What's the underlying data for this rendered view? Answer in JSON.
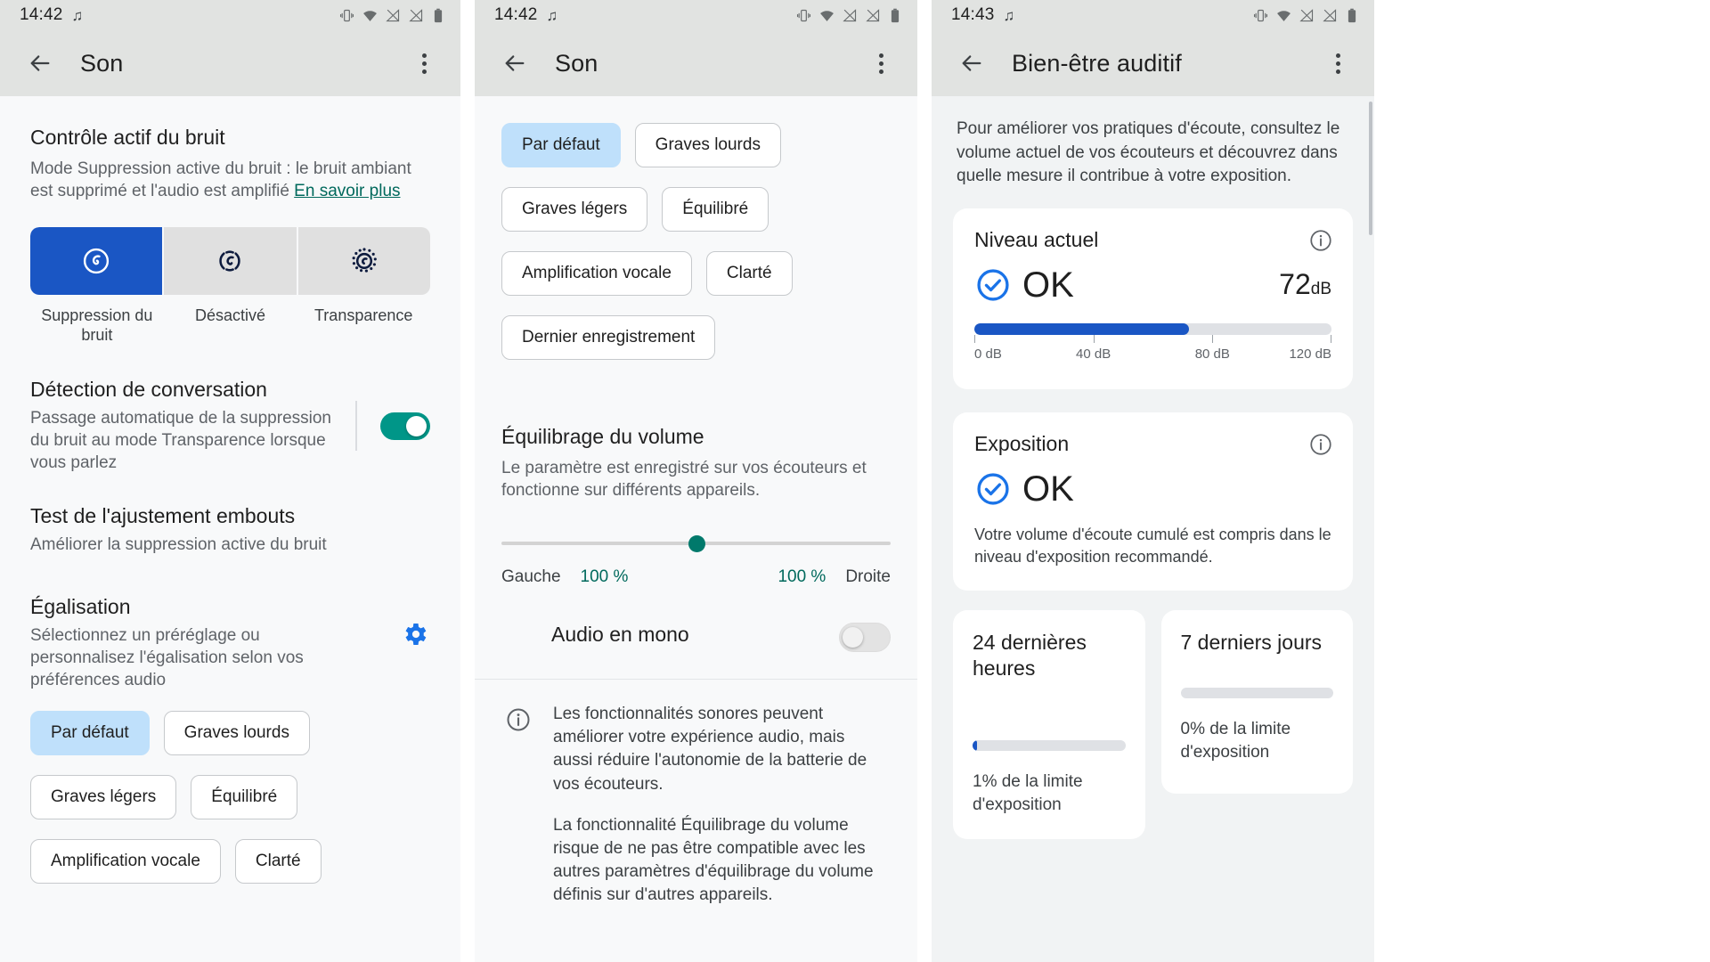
{
  "panels": [
    {
      "status": {
        "time": "14:42",
        "music_icon": "music-note-icon"
      },
      "appbar": {
        "back_icon": "back-arrow-icon",
        "title": "Son",
        "overflow_icon": "more-vert-icon"
      },
      "anc": {
        "title": "Contrôle actif du bruit",
        "subtitle": "Mode Suppression active du bruit : le bruit ambiant est supprimé et l'audio est amplifié",
        "link": "En savoir plus",
        "options": [
          {
            "label": "Suppression du bruit",
            "icon": "noise-cancelling-icon",
            "selected": true
          },
          {
            "label": "Désactivé",
            "icon": "anc-off-icon",
            "selected": false
          },
          {
            "label": "Transparence",
            "icon": "transparency-icon",
            "selected": false
          }
        ]
      },
      "conversation": {
        "title": "Détection de conversation",
        "subtitle": "Passage automatique de la suppression du bruit au mode Transparence lorsque vous parlez",
        "toggle_on": true
      },
      "fit_test": {
        "title": "Test de l'ajustement embouts",
        "subtitle": "Améliorer la suppression active du bruit"
      },
      "eq": {
        "title": "Égalisation",
        "subtitle": "Sélectionnez un préréglage ou personnalisez l'égalisation selon vos préférences audio",
        "gear_icon": "gear-icon",
        "presets": [
          {
            "label": "Par défaut",
            "selected": true
          },
          {
            "label": "Graves lourds",
            "selected": false
          },
          {
            "label": "Graves légers",
            "selected": false
          },
          {
            "label": "Équilibré",
            "selected": false
          },
          {
            "label": "Amplification vocale",
            "selected": false
          },
          {
            "label": "Clarté",
            "selected": false
          }
        ]
      }
    },
    {
      "status": {
        "time": "14:42",
        "music_icon": "music-note-icon"
      },
      "appbar": {
        "back_icon": "back-arrow-icon",
        "title": "Son",
        "overflow_icon": "more-vert-icon"
      },
      "eq_presets": [
        {
          "label": "Par défaut",
          "selected": true
        },
        {
          "label": "Graves lourds",
          "selected": false
        },
        {
          "label": "Graves légers",
          "selected": false
        },
        {
          "label": "Équilibré",
          "selected": false
        },
        {
          "label": "Amplification vocale",
          "selected": false
        },
        {
          "label": "Clarté",
          "selected": false
        },
        {
          "label": "Dernier enregistrement",
          "selected": false
        }
      ],
      "balance": {
        "title": "Équilibrage du volume",
        "subtitle": "Le paramètre est enregistré sur vos écouteurs et fonctionne sur différents appareils.",
        "left_label": "Gauche",
        "right_label": "Droite",
        "left_value": "100 %",
        "right_value": "100 %",
        "thumb_percent": 50
      },
      "mono": {
        "label": "Audio en mono",
        "toggle_on": false
      },
      "note": {
        "icon": "info-icon",
        "paragraphs": [
          "Les fonctionnalités sonores peuvent améliorer votre expérience audio, mais aussi réduire l'autonomie de la batterie de vos écouteurs.",
          "La fonctionnalité Équilibrage du volume risque de ne pas être compatible avec les autres paramètres d'équilibrage du volume définis sur d'autres appareils."
        ]
      }
    },
    {
      "status": {
        "time": "14:43",
        "music_icon": "music-note-icon"
      },
      "appbar": {
        "back_icon": "back-arrow-icon",
        "title": "Bien-être auditif",
        "overflow_icon": "more-vert-icon"
      },
      "intro": "Pour améliorer vos pratiques d'écoute, consultez le volume actuel de vos écouteurs et découvrez dans quelle mesure il contribue à votre exposition.",
      "current_level": {
        "title": "Niveau actuel",
        "info_icon": "info-outline-icon",
        "status_icon": "check-circle-icon",
        "status": "OK",
        "value": "72",
        "unit": "dB",
        "fill_percent": 60,
        "scale_labels": [
          "0 dB",
          "40 dB",
          "80 dB",
          "120 dB"
        ]
      },
      "exposure": {
        "title": "Exposition",
        "info_icon": "info-outline-icon",
        "status_icon": "check-circle-icon",
        "status": "OK",
        "text": "Votre volume d'écoute cumulé est compris dans le niveau d'exposition recommandé."
      },
      "mini_cards": [
        {
          "title": "24 dernières heures",
          "fill_percent": 3,
          "caption": "1% de la limite d'exposition"
        },
        {
          "title": "7 derniers jours",
          "fill_percent": 0,
          "caption": "0% de la limite d'exposition"
        }
      ]
    }
  ],
  "chart_data": {
    "type": "bar",
    "title": "Niveau actuel / Exposition",
    "categories": [
      "Niveau actuel (dB)",
      "24 dernières heures (%)",
      "7 derniers jours (%)"
    ],
    "values": [
      72,
      1,
      0
    ],
    "xlabel": "",
    "ylabel": "",
    "ylim": [
      0,
      120
    ],
    "axis_ticks": [
      "0 dB",
      "40 dB",
      "80 dB",
      "120 dB"
    ],
    "grid": false,
    "legend": "none"
  },
  "colors": {
    "accent_blue": "#1a56c4",
    "teal": "#009688",
    "chip_selected": "#bfe0fb",
    "link_green": "#00695c",
    "surface": "#f8f9fa",
    "bar_bg": "#e1e3e1"
  }
}
